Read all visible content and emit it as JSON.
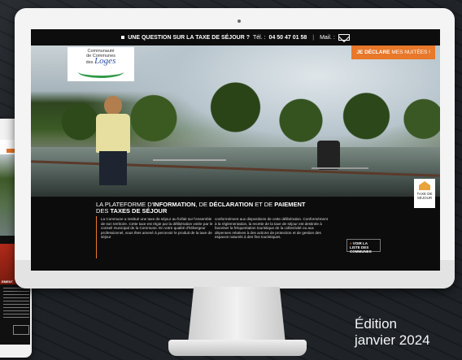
{
  "site": {
    "topbar": {
      "question": "UNE QUESTION SUR LA TAXE DE SÉJOUR ?",
      "tel_label": "Tél. :",
      "phone": "04 50 47 01 58",
      "separator": "|",
      "mail_label": "Mail. :"
    },
    "logo": {
      "line1": "Communauté",
      "line2": "de Communes",
      "line3_small": "des",
      "line3_big": "Loges",
      "swoosh_color": "#2f9a47",
      "name_color": "#2a4da0"
    },
    "declare_button": {
      "bold": "JE DÉCLARE",
      "light": "MES NUITÉES !",
      "color": "#e8782a"
    },
    "headline": {
      "p1": "LA PLATEFORME D'",
      "b1": "INFORMATION",
      "p2": ", DE ",
      "b2": "DÉCLARATION",
      "p3": " ET DE ",
      "b3": "PAIEMENT",
      "p4": "DES ",
      "b4": "TAXES DE SÉJOUR"
    },
    "body_col1": "La Commune  a institué une taxe de séjour au forfait sur l'ensemble de son territoire. Cette taxe est régie par la délibération votée par le conseil municipal de la Commune. En votre qualité d'hébergeur professionnel, vous êtes amené à percevoir le produit de la taxe de séjour",
    "body_col2": "conformément aux dispositions de cette délibération. Conformément à la réglementation, la recette de la taxe de séjour est destinée à favoriser la fréquentation touristique de la collectivité ou aux dépenses relatives à des actions de protection et de gestion des espaces naturels à des fins touristiques.",
    "list_button": {
      "marker": "»",
      "label": "VOIR LA LISTE DES COMMUNES"
    },
    "taxe_badge": {
      "line1": "TAXE DE",
      "line2": "SÉJOUR"
    }
  },
  "caption": {
    "line1": "Édition",
    "line2": "janvier 2024"
  }
}
